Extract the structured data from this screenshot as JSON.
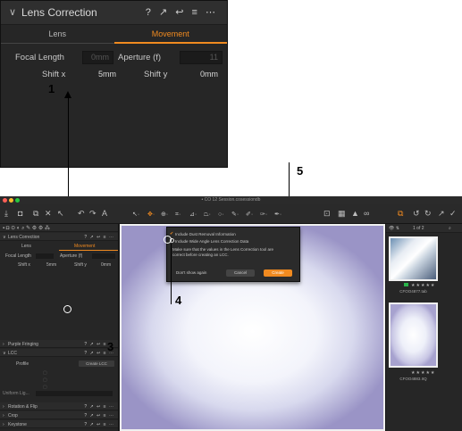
{
  "colors": {
    "accent": "#f08a20",
    "panel": "#262626"
  },
  "zoom_panel": {
    "title": "Lens Correction",
    "tools": "? ↗ ↩ ≡ ⋯",
    "tabs": [
      {
        "label": "Lens"
      },
      {
        "label": "Movement"
      }
    ],
    "focal_length_label": "Focal Length",
    "focal_length_value": "0mm",
    "aperture_label": "Aperture (f)",
    "aperture_value": "11",
    "shift_x_label": "Shift  x",
    "shift_x_value": "5mm",
    "shift_y_label": "Shift  y",
    "shift_y_value": "0mm"
  },
  "callouts": {
    "one": "1",
    "three": "3",
    "four": "4",
    "five": "5"
  },
  "app": {
    "window_title": "• CO 12 Session.cosessiondb",
    "toolbar_left_letter": "A",
    "left_panel": {
      "lens_correction": "Lens Correction",
      "lens_tab": "Lens",
      "movement_tab": "Movement",
      "focal_length": "Focal Length",
      "aperture": "Aperture (f)",
      "shift_x": "Shift  x",
      "shift_y": "Shift  y",
      "shift_x_value": "5mm",
      "shift_y_value": "0mm",
      "purple_fringing": "Purple Fringing",
      "lcc": "LCC",
      "profile": "Profile",
      "create_lcc": "Create LCC",
      "uniform_light": "Uniform Lig...",
      "rotation_flip": "Rotation & Flip",
      "crop": "Crop",
      "keystone": "Keystone"
    },
    "dialog": {
      "option1": "Include Dust Removal Information",
      "option2": "Include Wide Angle Lens Correction Data",
      "note_line1": "Make sure that the values in the Lens Correction tool are",
      "note_line2": "correct before creating an LCC.",
      "dont_show": "Don't show again",
      "cancel": "Cancel",
      "create": "Create"
    },
    "right_panel": {
      "count": "1 of 2",
      "thumb1_label": "CFOO4877.tab",
      "thumb2_label": "CFOO4883.IIQ",
      "stars": "★★★★★"
    }
  }
}
